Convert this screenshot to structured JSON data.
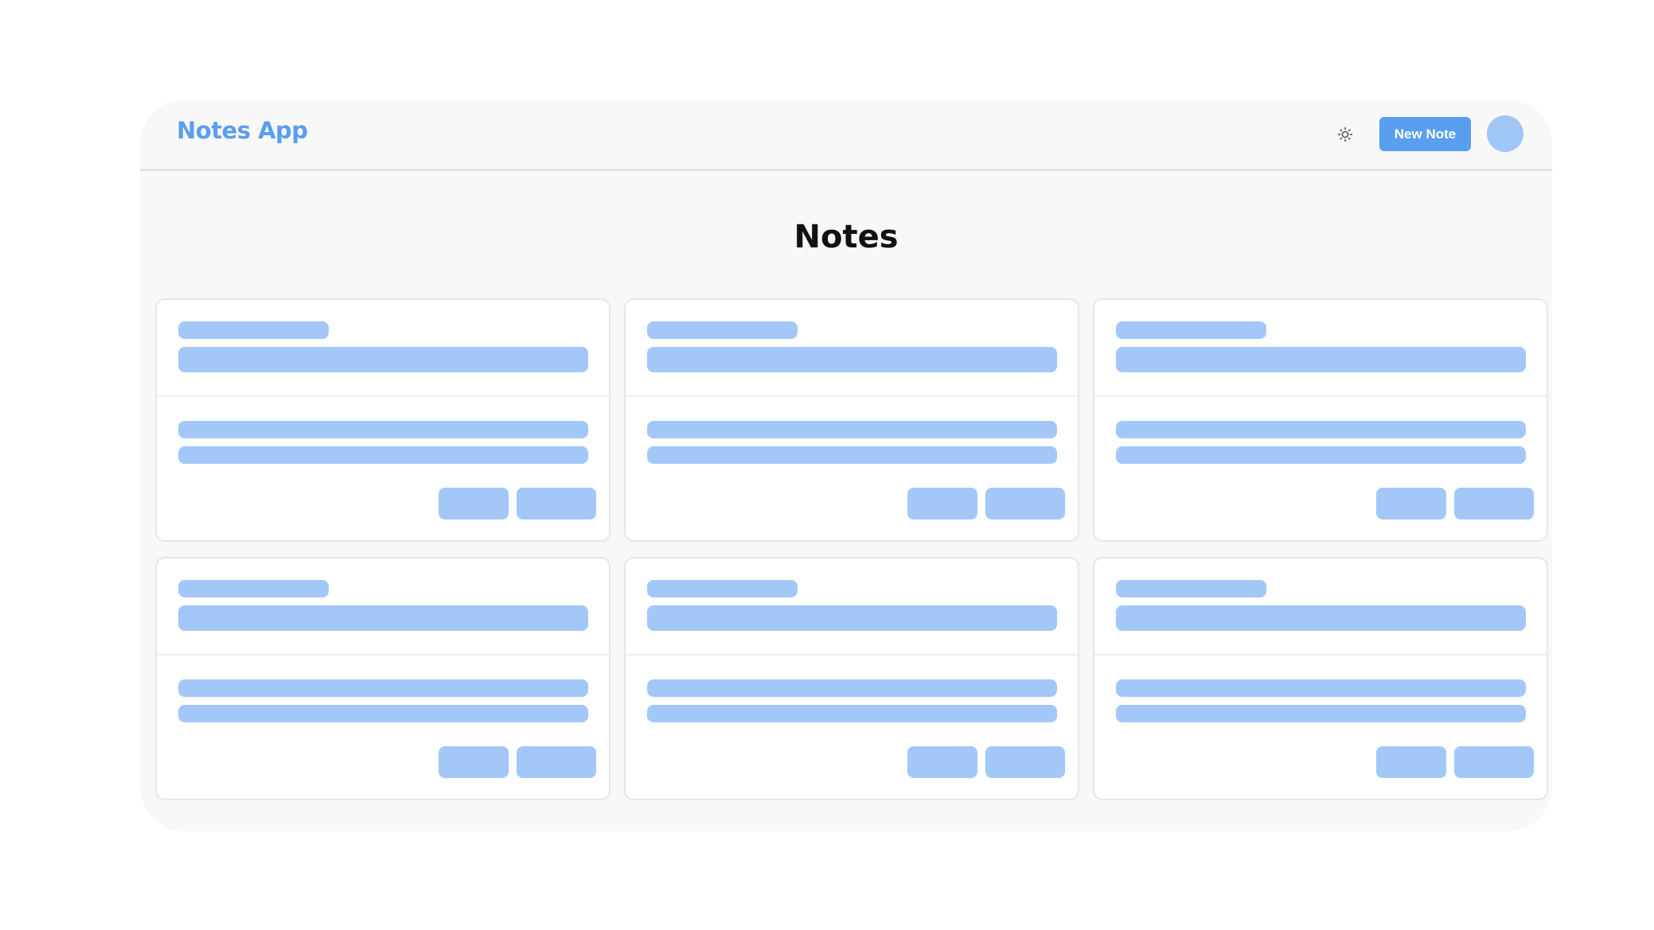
{
  "header": {
    "brand": "Notes App",
    "theme_icon": "sun-icon",
    "new_note_label": "New Note",
    "avatar_icon": "avatar"
  },
  "main": {
    "title": "Notes",
    "cards": [
      {
        "state": "loading"
      },
      {
        "state": "loading"
      },
      {
        "state": "loading"
      },
      {
        "state": "loading"
      },
      {
        "state": "loading"
      },
      {
        "state": "loading"
      }
    ]
  },
  "colors": {
    "accent": "#5a9ef0",
    "skeleton": "#a3c8f8",
    "avatar": "#9fc6f7",
    "surface": "#f8f8f8",
    "card": "#ffffff"
  }
}
